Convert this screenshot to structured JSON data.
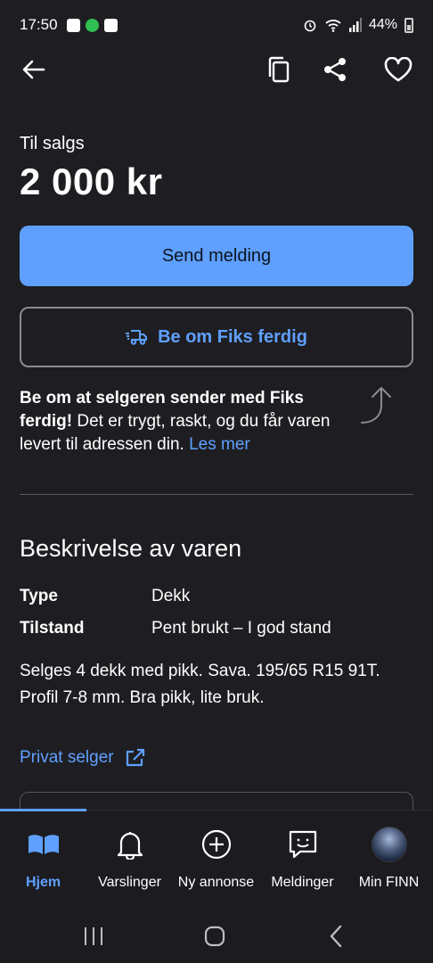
{
  "status_bar": {
    "time": "17:50",
    "battery": "44%"
  },
  "top_bar": {
    "icons": [
      "back-arrow-icon",
      "copy-icon",
      "share-icon",
      "heart-icon"
    ]
  },
  "listing": {
    "status": "Til salgs",
    "price": "2 000 kr"
  },
  "actions": {
    "send_message": "Send melding",
    "fiks_ferdig": "Be om Fiks ferdig"
  },
  "fiks_info": {
    "bold": "Be om at selgeren sender med Fiks ferdig!",
    "text": " Det er trygt, raskt, og du får varen levert til adressen din. ",
    "link": "Les mer"
  },
  "description": {
    "title": "Beskrivelse av varen",
    "rows": [
      {
        "label": "Type",
        "value": "Dekk"
      },
      {
        "label": "Tilstand",
        "value": "Pent brukt – I god stand"
      }
    ],
    "body": "Selges 4 dekk med pikk. Sava. 195/65 R15 91T. Profil 7-8 mm. Bra pikk, lite bruk."
  },
  "seller": {
    "label": "Privat selger"
  },
  "bottom_nav": {
    "items": [
      {
        "label": "Hjem",
        "icon": "book-icon",
        "active": true
      },
      {
        "label": "Varslinger",
        "icon": "bell-icon",
        "active": false
      },
      {
        "label": "Ny annonse",
        "icon": "plus-circle-icon",
        "active": false
      },
      {
        "label": "Meldinger",
        "icon": "chat-icon",
        "active": false
      },
      {
        "label": "Min FINN",
        "icon": "avatar",
        "active": false
      }
    ]
  },
  "colors": {
    "background": "#1e1e22",
    "accent": "#5fa0ff",
    "text": "#ffffff"
  }
}
